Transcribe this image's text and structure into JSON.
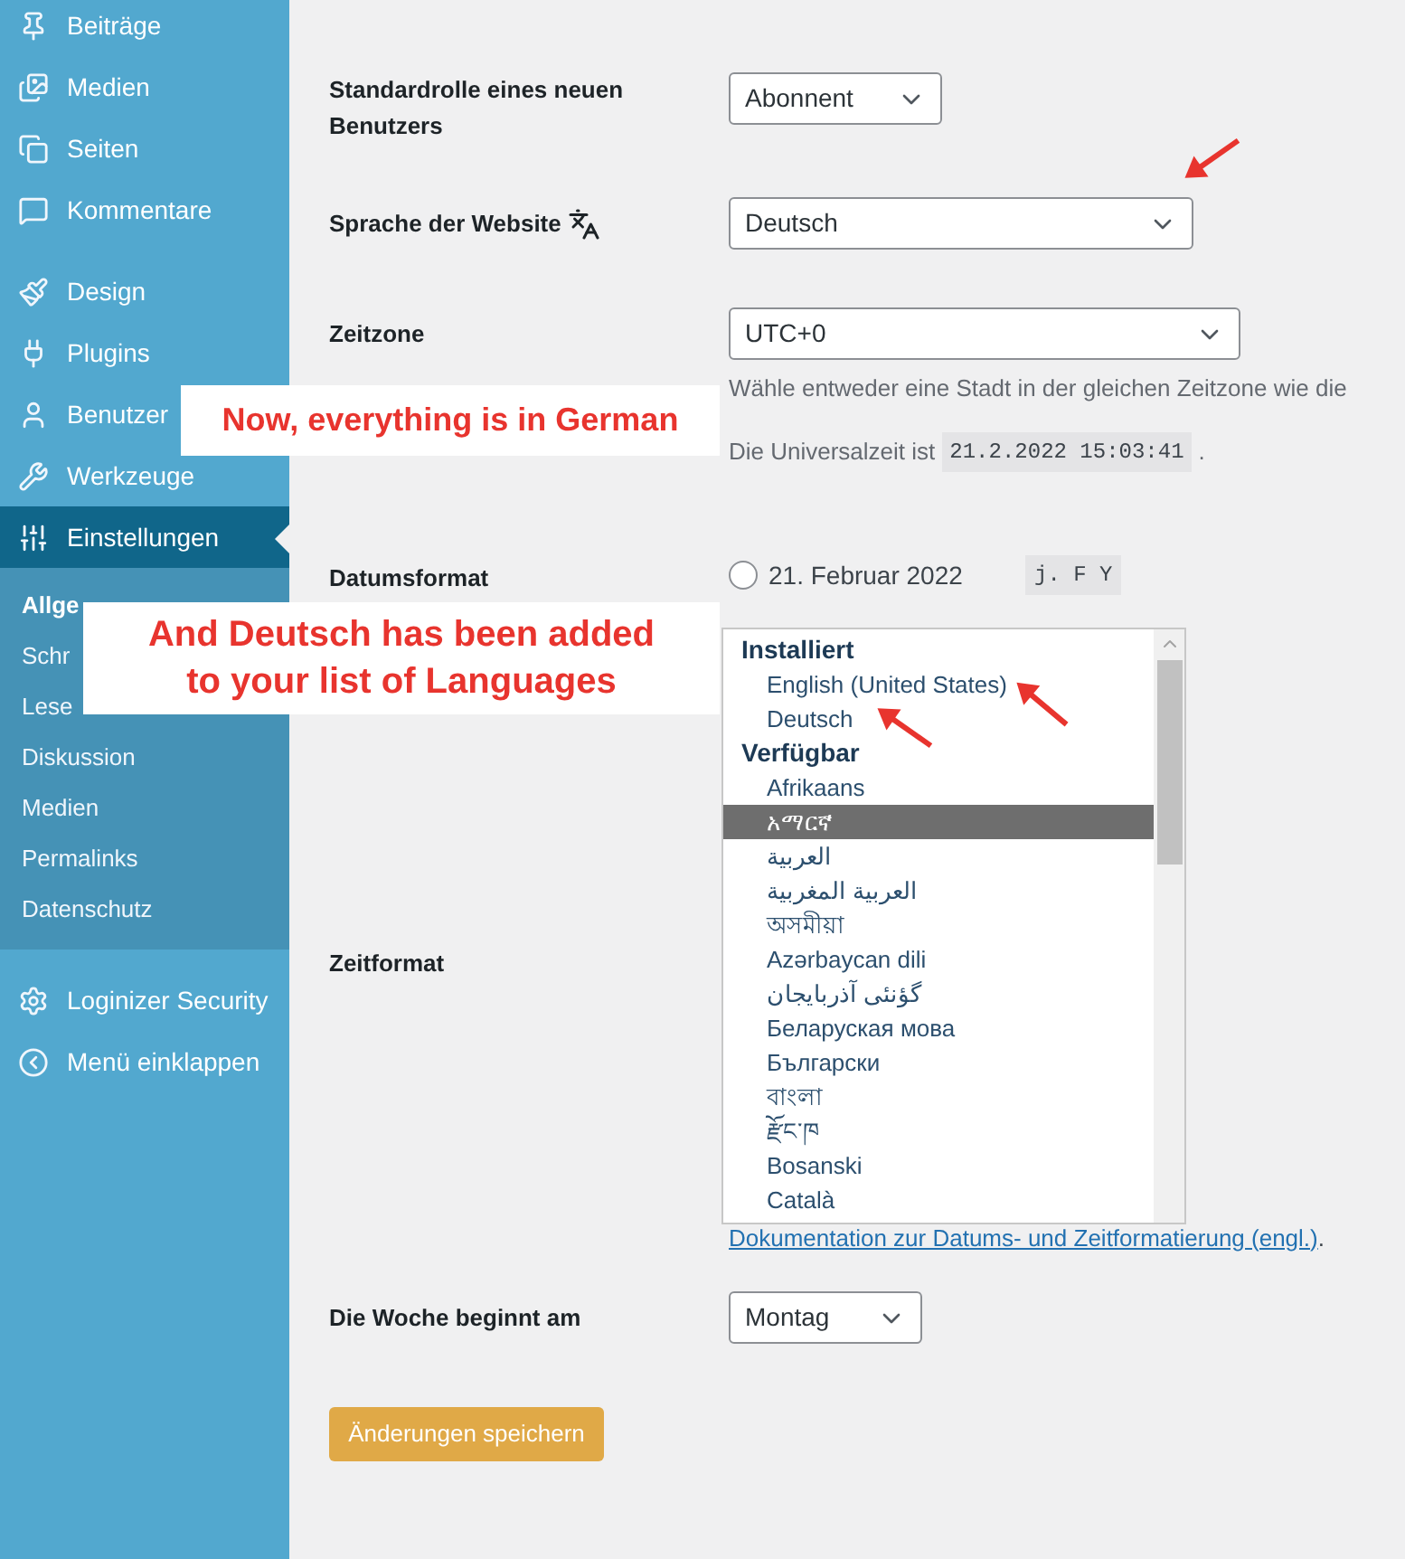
{
  "sidebar": {
    "sections": [
      {
        "items": [
          {
            "label": "Beiträge",
            "selected": false
          },
          {
            "label": "Medien",
            "selected": false
          },
          {
            "label": "Seiten",
            "selected": false
          },
          {
            "label": "Kommentare",
            "selected": false
          }
        ]
      },
      {
        "items": [
          {
            "label": "Design",
            "selected": false
          },
          {
            "label": "Plugins",
            "selected": false
          },
          {
            "label": "Benutzer",
            "selected": false
          },
          {
            "label": "Werkzeuge",
            "selected": false
          },
          {
            "label": "Einstellungen",
            "selected": true,
            "children": [
              {
                "label": "Allge",
                "selected": true
              },
              {
                "label": "Schr",
                "selected": false
              },
              {
                "label": "Lese",
                "selected": false
              },
              {
                "label": "Diskussion",
                "selected": false
              },
              {
                "label": "Medien",
                "selected": false
              },
              {
                "label": "Permalinks",
                "selected": false
              },
              {
                "label": "Datenschutz",
                "selected": false
              }
            ]
          }
        ]
      },
      {
        "items": [
          {
            "label": "Loginizer Security",
            "selected": false
          },
          {
            "label": "Menü einklappen",
            "selected": false
          }
        ]
      }
    ]
  },
  "settings": {
    "default_role": {
      "label": "Standardrolle eines neuen Benutzers",
      "value": "Abonnent"
    },
    "site_language": {
      "label": "Sprache der Website",
      "value": "Deutsch"
    },
    "timezone": {
      "label": "Zeitzone",
      "value": "UTC+0",
      "description": "Wähle entweder eine Stadt in der gleichen Zeitzone wie die",
      "universal_time_label": "Die Universalzeit ist",
      "universal_time": "21.2.2022 15:03:41",
      "universal_time_end": "."
    },
    "date_format": {
      "label": "Datumsformat",
      "options": [
        {
          "label": "21. Februar 2022",
          "code": "j. F Y",
          "selected": false
        }
      ]
    },
    "time_format": {
      "label": "Zeitformat",
      "doc_link": "Dokumentation zur Datums- und Zeitformatierung (engl.)",
      "doc_link_end": "."
    },
    "week_start": {
      "label": "Die Woche beginnt am",
      "value": "Montag"
    },
    "save_button": "Änderungen speichern"
  },
  "language_dropdown": {
    "groups": [
      {
        "label": "Installiert",
        "options": [
          {
            "label": "English (United States)",
            "selected": false
          },
          {
            "label": "Deutsch",
            "selected": false
          }
        ]
      },
      {
        "label": "Verfügbar",
        "options": [
          {
            "label": "Afrikaans",
            "selected": false
          },
          {
            "label": "አማርኛ",
            "selected": true
          },
          {
            "label": "العربية",
            "selected": false
          },
          {
            "label": "العربية المغربية",
            "selected": false
          },
          {
            "label": "অসমীয়া",
            "selected": false
          },
          {
            "label": "Azərbaycan dili",
            "selected": false
          },
          {
            "label": "گؤنئی آذربایجان",
            "selected": false
          },
          {
            "label": "Беларуская мова",
            "selected": false
          },
          {
            "label": "Български",
            "selected": false
          },
          {
            "label": "বাংলা",
            "selected": false
          },
          {
            "label": "རྫོང་ཁ",
            "selected": false
          },
          {
            "label": "Bosanski",
            "selected": false
          },
          {
            "label": "Català",
            "selected": false
          }
        ]
      }
    ]
  },
  "annotations": [
    {
      "text": "Now, everything is in German"
    },
    {
      "text": "And Deutsch has been added to your list of Languages"
    }
  ]
}
